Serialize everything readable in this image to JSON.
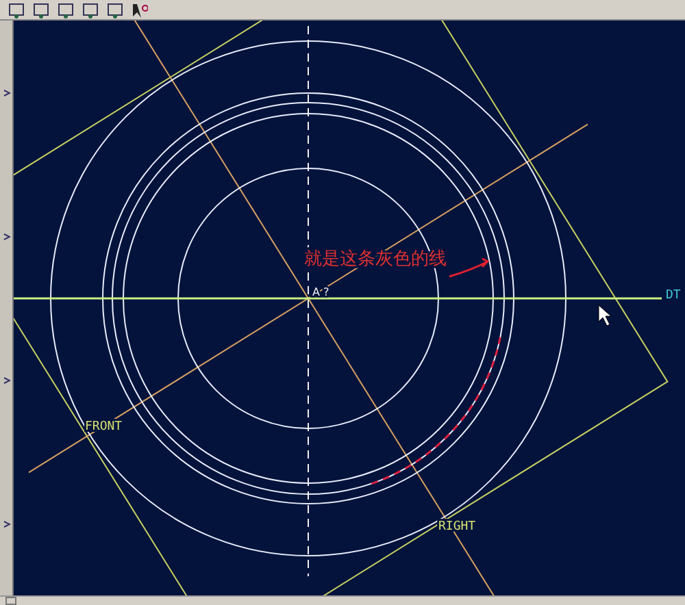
{
  "annotation": {
    "text": "就是这条灰色的线"
  },
  "datum_labels": [
    {
      "text": "DT",
      "kind": "plane"
    },
    {
      "text": "FRONT",
      "kind": "plane"
    },
    {
      "text": "RIGHT",
      "kind": "plane"
    }
  ],
  "point_labels": [
    "A",
    "?"
  ]
}
